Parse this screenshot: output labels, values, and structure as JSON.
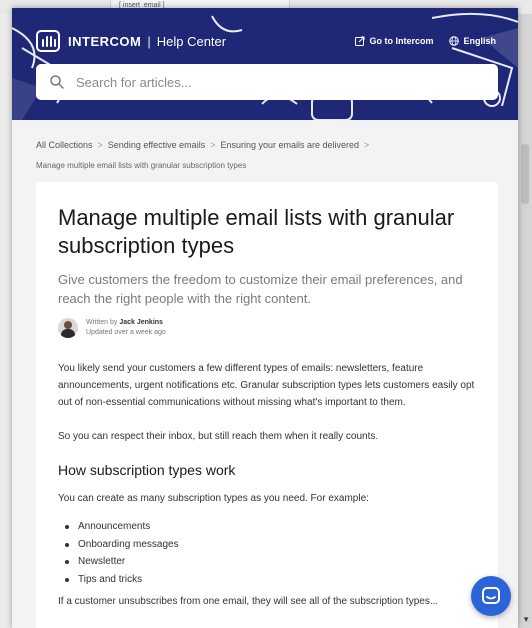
{
  "background": {
    "tab_text": "[ insert_email ]"
  },
  "header": {
    "brand": "INTERCOM",
    "separator": "|",
    "subtitle": "Help Center",
    "links": {
      "goto": "Go to Intercom",
      "language": "English"
    }
  },
  "search": {
    "placeholder": "Search for articles..."
  },
  "breadcrumb": {
    "items": [
      "All Collections",
      "Sending effective emails",
      "Ensuring your emails are delivered"
    ],
    "current": "Manage multiple email lists with granular subscription types"
  },
  "article": {
    "title": "Manage multiple email lists with granular subscription types",
    "lead": "Give customers the freedom to customize their email preferences, and reach the right people with the right content.",
    "author": {
      "prefix": "Written by",
      "name": "Jack Jenkins",
      "updated": "Updated over a week ago"
    },
    "paragraphs": [
      "You likely send your customers a few different types of emails: newsletters, feature announcements, urgent notifications etc. Granular subscription types lets customers easily opt out of non-essential communications without missing what's important to them.",
      "So you can respect their inbox, but still reach them when it really counts."
    ],
    "section_heading": "How subscription types work",
    "section_intro": "You can create as many subscription types as you need. For example:",
    "list": [
      "Announcements",
      "Onboarding messages",
      "Newsletter",
      "Tips and tricks"
    ],
    "cut_text": "If a customer unsubscribes from one email, they will see all of the subscription types..."
  },
  "colors": {
    "hero": "#1f2877",
    "launcher": "#2b64d8"
  }
}
